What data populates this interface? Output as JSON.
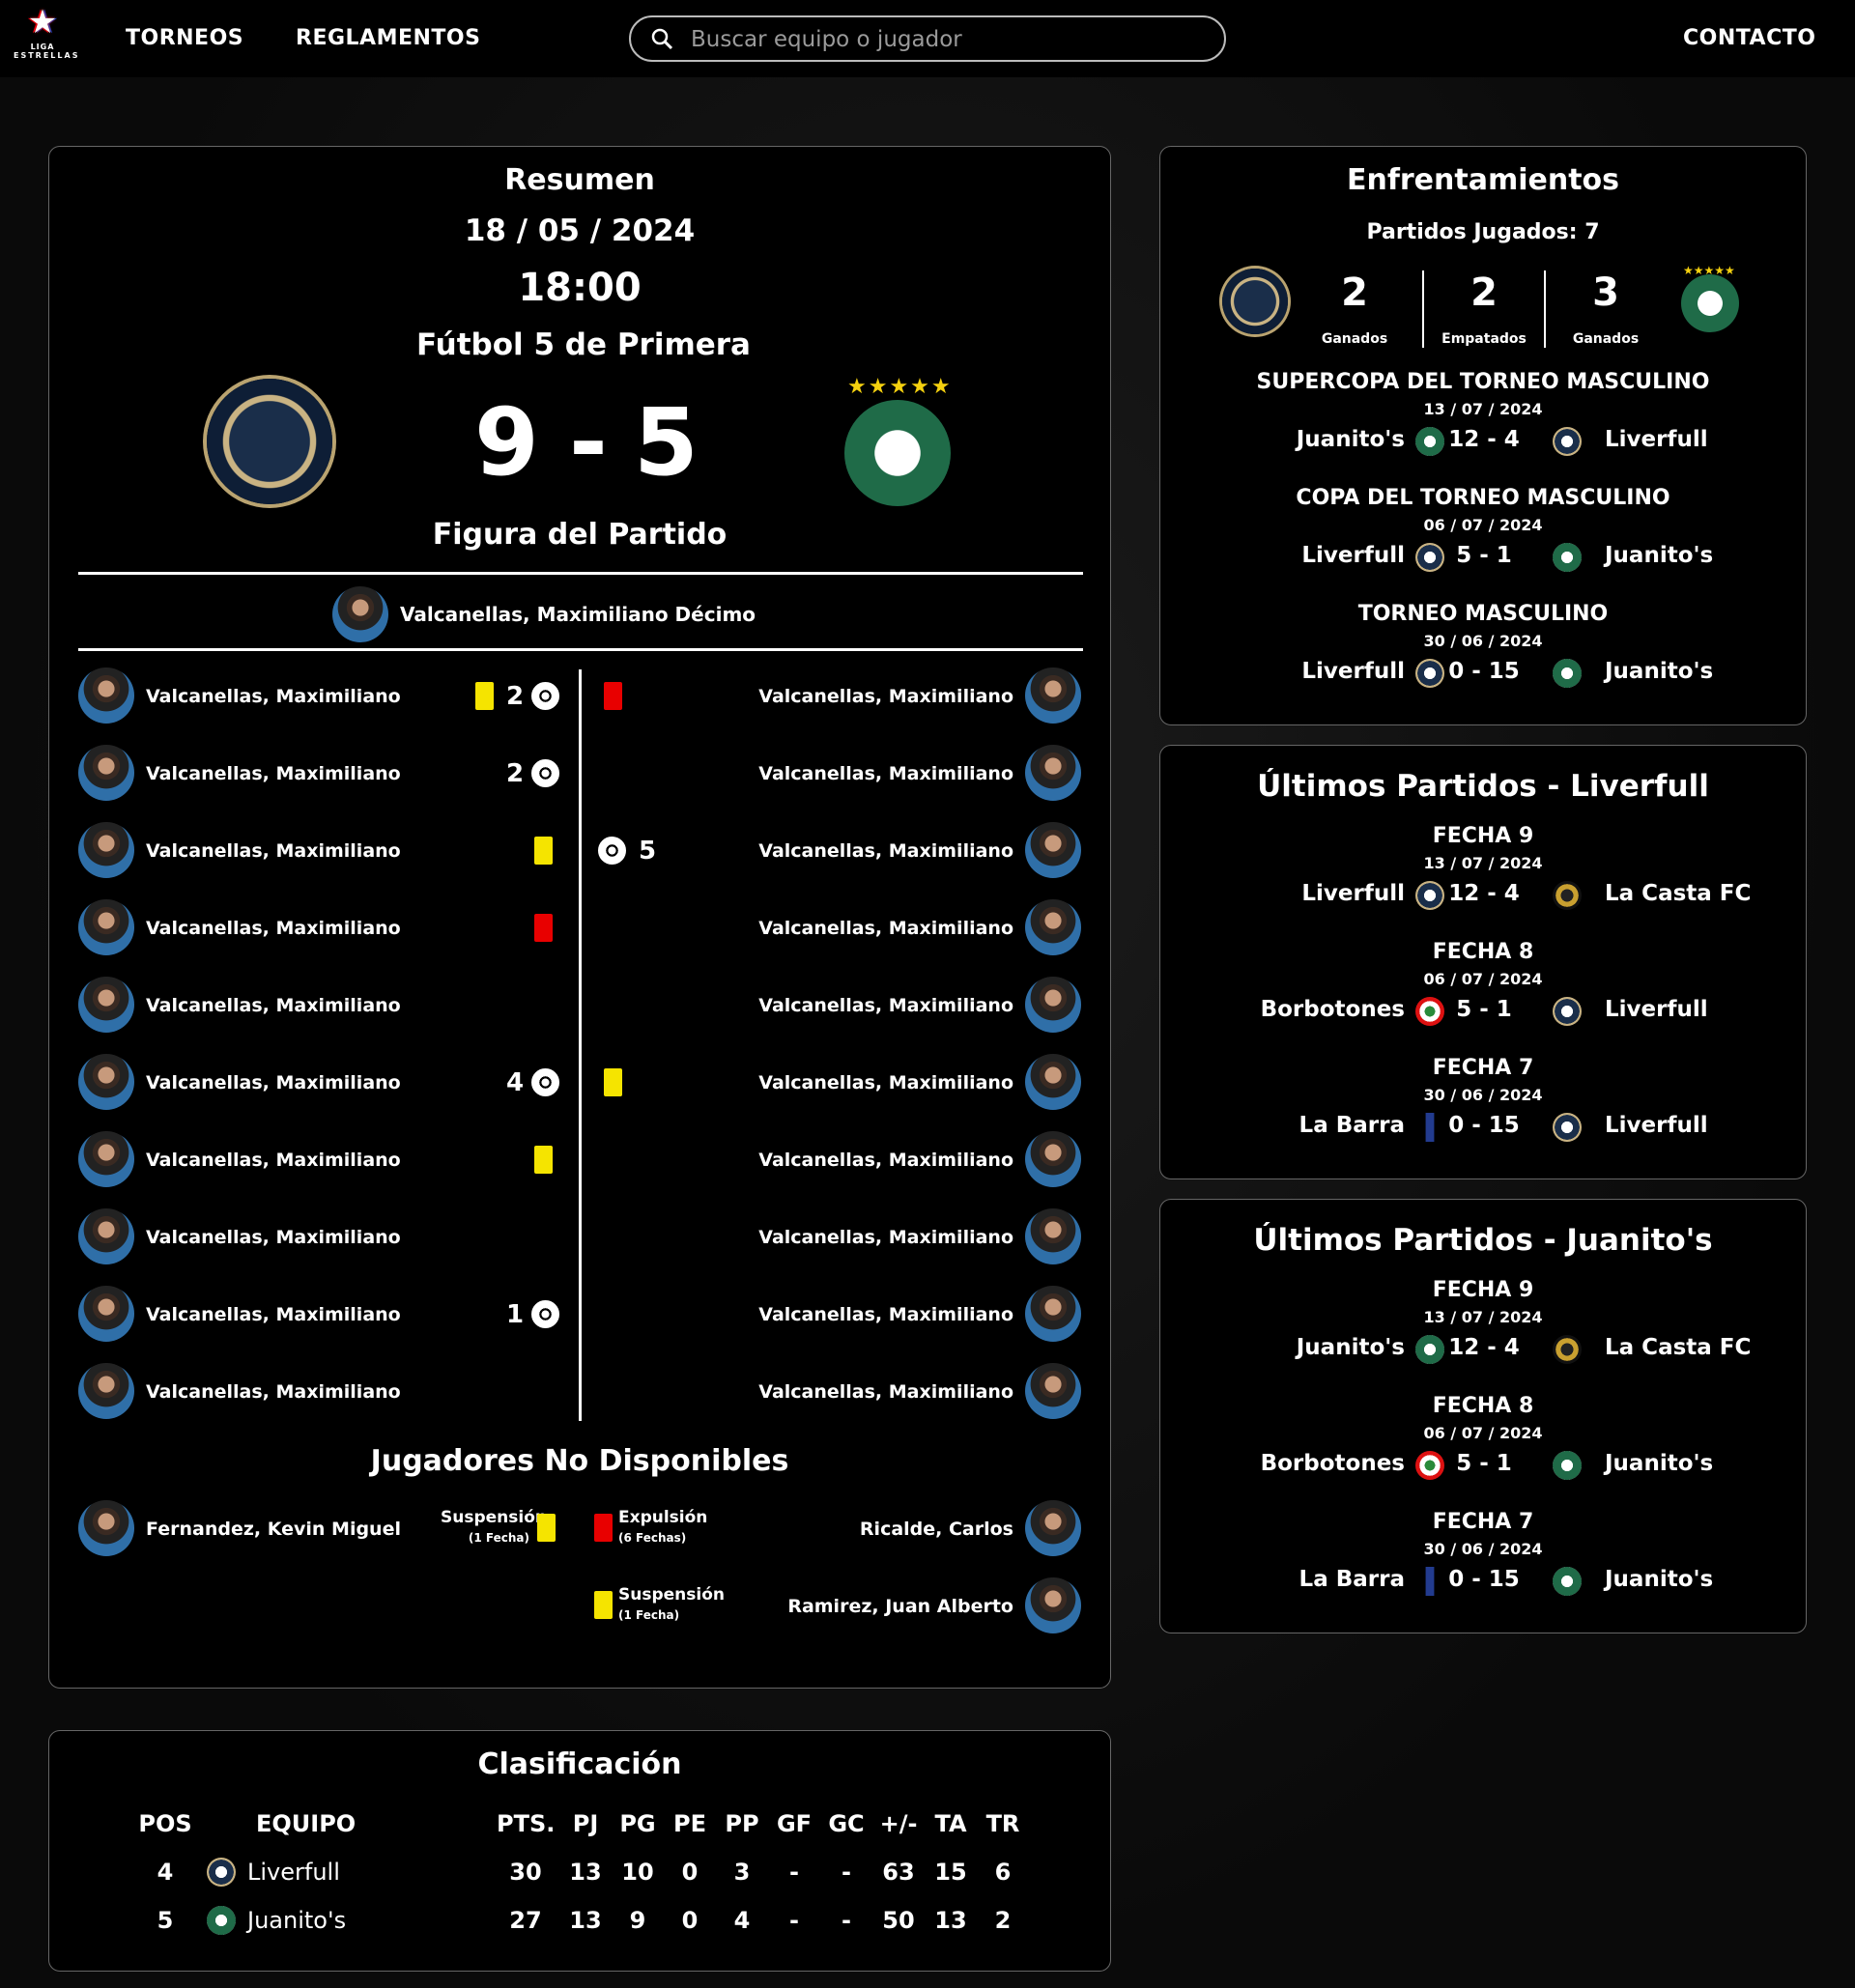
{
  "nav": {
    "logo_l1": "LIGA",
    "logo_l2": "ESTRELLAS",
    "torneos": "TORNEOS",
    "reglamentos": "REGLAMENTOS",
    "search_placeholder": "Buscar equipo o jugador",
    "contacto": "CONTACTO"
  },
  "resumen": {
    "title": "Resumen",
    "date": "18 / 05 / 2024",
    "time": "18:00",
    "category": "Fútbol 5 de Primera",
    "home_team": "Liverfull",
    "away_team": "Juanito's",
    "home_score": "9",
    "sep": "-",
    "away_score": "5",
    "mvp_title": "Figura del Partido",
    "mvp_name": "Valcanellas, Maximiliano Décimo",
    "home_players": [
      {
        "name": "Valcanellas, Maximiliano",
        "yellow": true,
        "red": false,
        "goals": "2"
      },
      {
        "name": "Valcanellas, Maximiliano",
        "yellow": false,
        "red": false,
        "goals": "2"
      },
      {
        "name": "Valcanellas, Maximiliano",
        "yellow": true,
        "red": false,
        "goals": ""
      },
      {
        "name": "Valcanellas, Maximiliano",
        "yellow": false,
        "red": true,
        "goals": ""
      },
      {
        "name": "Valcanellas, Maximiliano",
        "yellow": false,
        "red": false,
        "goals": ""
      },
      {
        "name": "Valcanellas, Maximiliano",
        "yellow": false,
        "red": false,
        "goals": "4"
      },
      {
        "name": "Valcanellas, Maximiliano",
        "yellow": true,
        "red": false,
        "goals": ""
      },
      {
        "name": "Valcanellas, Maximiliano",
        "yellow": false,
        "red": false,
        "goals": ""
      },
      {
        "name": "Valcanellas, Maximiliano",
        "yellow": false,
        "red": false,
        "goals": "1"
      },
      {
        "name": "Valcanellas, Maximiliano",
        "yellow": false,
        "red": false,
        "goals": ""
      }
    ],
    "away_players": [
      {
        "name": "Valcanellas, Maximiliano",
        "yellow": false,
        "red": true,
        "goals": ""
      },
      {
        "name": "Valcanellas, Maximiliano",
        "yellow": false,
        "red": false,
        "goals": ""
      },
      {
        "name": "Valcanellas, Maximiliano",
        "yellow": false,
        "red": false,
        "goals": "5"
      },
      {
        "name": "Valcanellas, Maximiliano",
        "yellow": false,
        "red": false,
        "goals": ""
      },
      {
        "name": "Valcanellas, Maximiliano",
        "yellow": false,
        "red": false,
        "goals": ""
      },
      {
        "name": "Valcanellas, Maximiliano",
        "yellow": true,
        "red": false,
        "goals": ""
      },
      {
        "name": "Valcanellas, Maximiliano",
        "yellow": false,
        "red": false,
        "goals": ""
      },
      {
        "name": "Valcanellas, Maximiliano",
        "yellow": false,
        "red": false,
        "goals": ""
      },
      {
        "name": "Valcanellas, Maximiliano",
        "yellow": false,
        "red": false,
        "goals": ""
      },
      {
        "name": "Valcanellas, Maximiliano",
        "yellow": false,
        "red": false,
        "goals": ""
      }
    ],
    "unavailable_title": "Jugadores No Disponibles",
    "unavailable_home": [
      {
        "name": "Fernandez, Kevin Miguel",
        "reason": "Suspensión",
        "detail": "(1 Fecha)",
        "card": "yellow"
      }
    ],
    "unavailable_away": [
      {
        "name": "Ricalde, Carlos",
        "reason": "Expulsión",
        "detail": "(6 Fechas)",
        "card": "red"
      },
      {
        "name": "Ramirez, Juan Alberto",
        "reason": "Suspensión",
        "detail": "(1 Fecha)",
        "card": "yellow"
      }
    ]
  },
  "enfrentamientos": {
    "title": "Enfrentamientos",
    "played": "Partidos Jugados: 7",
    "home_wins": "2",
    "home_wins_label": "Ganados",
    "draws": "2",
    "draws_label": "Empatados",
    "away_wins": "3",
    "away_wins_label": "Ganados",
    "matches": [
      {
        "tournament": "SUPERCOPA DEL TORNEO MASCULINO",
        "date": "13 / 07 / 2024",
        "home": "Juanito's",
        "home_badge": "jua",
        "score": "12 - 4",
        "away": "Liverfull",
        "away_badge": "liv"
      },
      {
        "tournament": "COPA DEL TORNEO MASCULINO",
        "date": "06 / 07 / 2024",
        "home": "Liverfull",
        "home_badge": "liv",
        "score": "5 - 1",
        "away": "Juanito's",
        "away_badge": "jua"
      },
      {
        "tournament": "TORNEO MASCULINO",
        "date": "30 / 06 / 2024",
        "home": "Liverfull",
        "home_badge": "liv",
        "score": "0 - 15",
        "away": "Juanito's",
        "away_badge": "jua"
      }
    ]
  },
  "ultimos_liv": {
    "title": "Últimos Partidos - Liverfull",
    "matches": [
      {
        "round": "FECHA 9",
        "date": "13 / 07 / 2024",
        "home": "Liverfull",
        "home_badge": "liv",
        "score": "12 - 4",
        "away": "La Casta FC",
        "away_badge": "casta"
      },
      {
        "round": "FECHA 8",
        "date": "06 / 07 / 2024",
        "home": "Borbotones",
        "home_badge": "borb",
        "score": "5 - 1",
        "away": "Liverfull",
        "away_badge": "liv"
      },
      {
        "round": "FECHA 7",
        "date": "30 / 06 / 2024",
        "home": "La Barra",
        "home_badge": "barra",
        "score": "0 - 15",
        "away": "Liverfull",
        "away_badge": "liv"
      }
    ]
  },
  "ultimos_jua": {
    "title": "Últimos Partidos - Juanito's",
    "matches": [
      {
        "round": "FECHA 9",
        "date": "13 / 07 / 2024",
        "home": "Juanito's",
        "home_badge": "jua",
        "score": "12 - 4",
        "away": "La Casta FC",
        "away_badge": "casta"
      },
      {
        "round": "FECHA 8",
        "date": "06 / 07 / 2024",
        "home": "Borbotones",
        "home_badge": "borb",
        "score": "5 - 1",
        "away": "Juanito's",
        "away_badge": "jua"
      },
      {
        "round": "FECHA 7",
        "date": "30 / 06 / 2024",
        "home": "La Barra",
        "home_badge": "barra",
        "score": "0 - 15",
        "away": "Juanito's",
        "away_badge": "jua"
      }
    ]
  },
  "clasificacion": {
    "title": "Clasificación",
    "headers": [
      "POS",
      "EQUIPO",
      "PTS.",
      "PJ",
      "PG",
      "PE",
      "PP",
      "GF",
      "GC",
      "+/-",
      "TA",
      "TR"
    ],
    "rows": [
      {
        "pos": "4",
        "team": "Liverfull",
        "badge": "liv",
        "pts": "30",
        "pj": "13",
        "pg": "10",
        "pe": "0",
        "pp": "3",
        "gf": "-",
        "gc": "-",
        "dif": "63",
        "ta": "15",
        "tr": "6"
      },
      {
        "pos": "5",
        "team": "Juanito's",
        "badge": "jua",
        "pts": "27",
        "pj": "13",
        "pg": "9",
        "pe": "0",
        "pp": "4",
        "gf": "-",
        "gc": "-",
        "dif": "50",
        "ta": "13",
        "tr": "2"
      }
    ]
  }
}
